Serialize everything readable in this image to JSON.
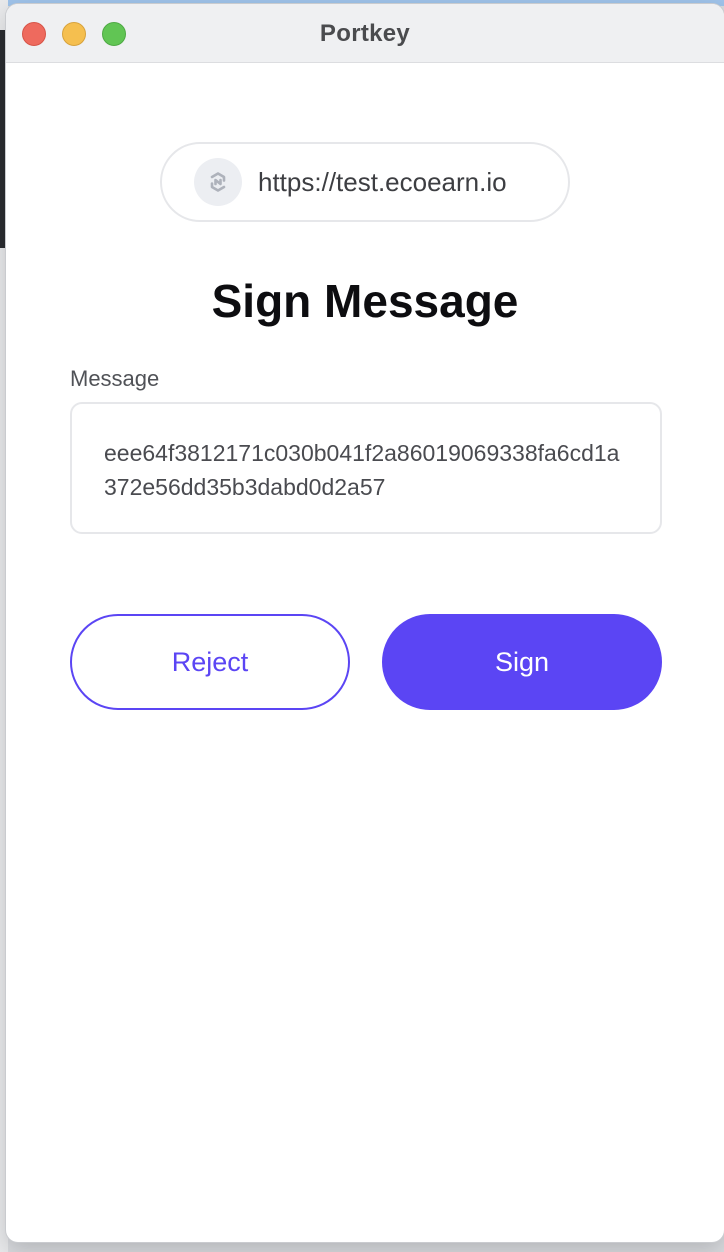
{
  "window": {
    "title": "Portkey"
  },
  "origin": {
    "url": "https://test.ecoearn.io",
    "icon": "site-logo-icon"
  },
  "page": {
    "heading": "Sign Message"
  },
  "message": {
    "label": "Message",
    "value": "eee64f3812171c030b041f2a86019069338fa6cd1a372e56dd35b3dabd0d2a57"
  },
  "actions": {
    "reject_label": "Reject",
    "sign_label": "Sign"
  },
  "colors": {
    "accent": "#5b45f4",
    "close": "#ee6a5e",
    "minimize": "#f5bf4f",
    "maximize": "#61c554"
  }
}
